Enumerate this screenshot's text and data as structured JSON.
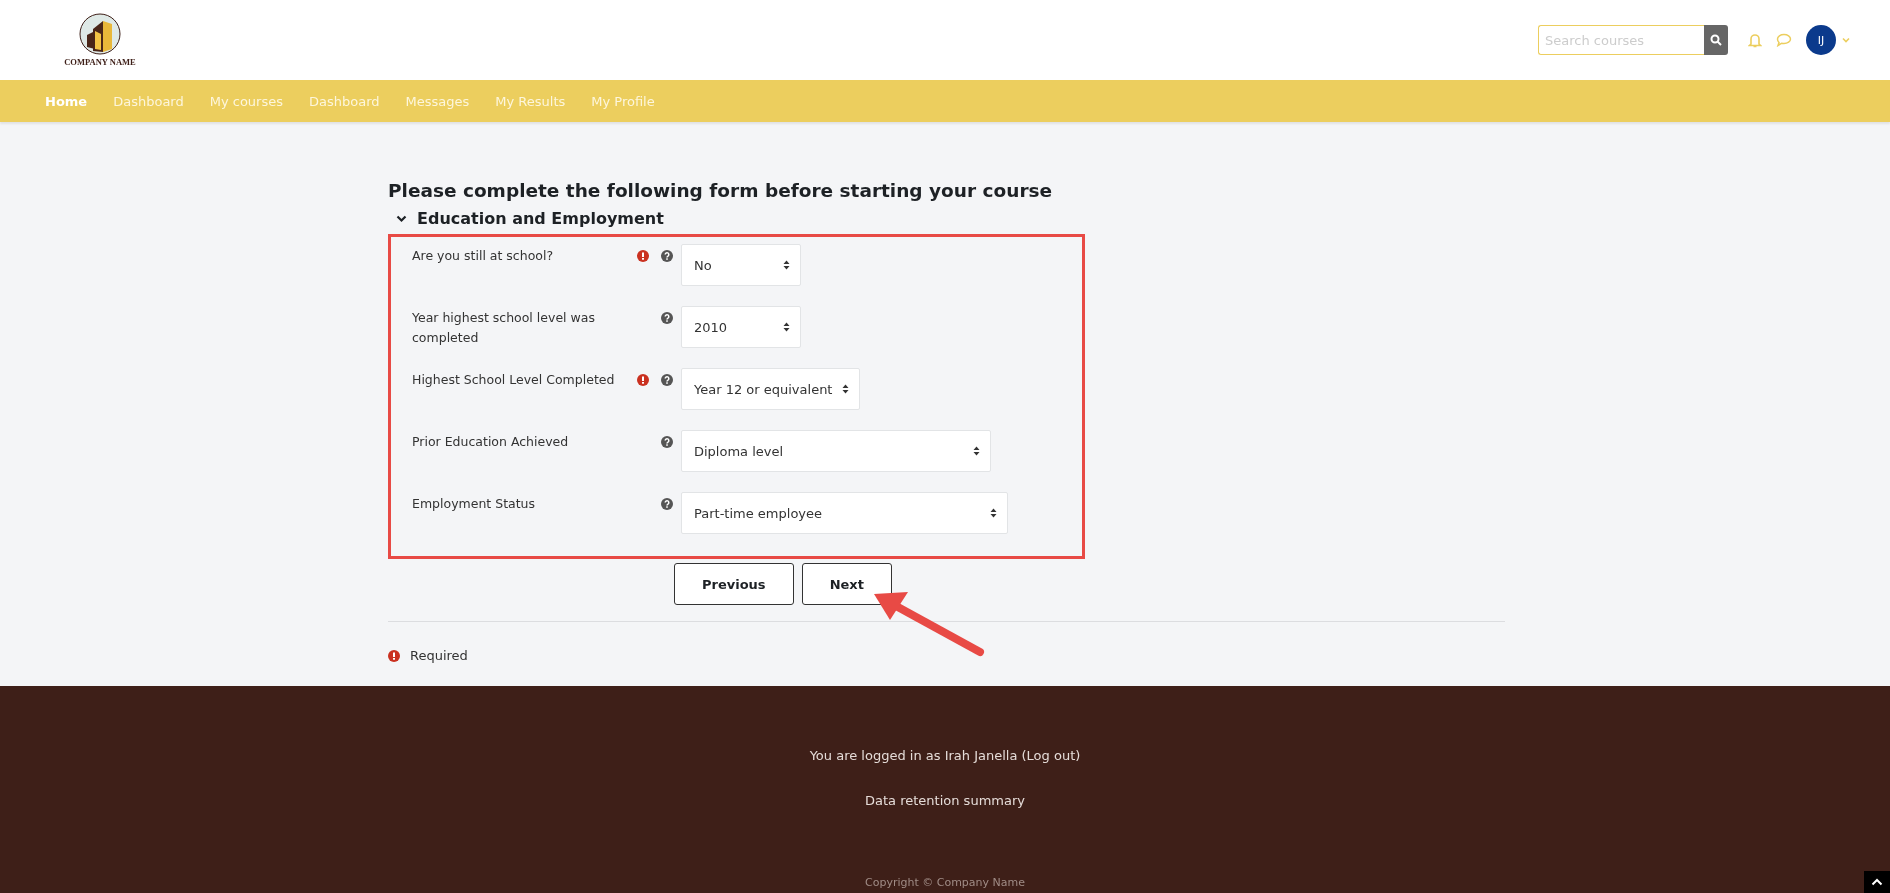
{
  "header": {
    "logo_text": "COMPANY NAME",
    "search": {
      "placeholder": "Search courses"
    },
    "avatar_initials": "IJ"
  },
  "nav": [
    {
      "label": "Home",
      "selected": true
    },
    {
      "label": "Dashboard",
      "selected": false
    },
    {
      "label": "My courses",
      "selected": false
    },
    {
      "label": "Dashboard",
      "selected": false
    },
    {
      "label": "Messages",
      "selected": false
    },
    {
      "label": "My Results",
      "selected": false
    },
    {
      "label": "My Profile",
      "selected": false
    }
  ],
  "page_title": "Please complete the following form before starting your course",
  "section": {
    "title": "Education and Employment",
    "expanded": true
  },
  "fields": [
    {
      "label": "Are you still at school?",
      "required": true,
      "value": "No"
    },
    {
      "label": "Year highest school level was completed",
      "required": false,
      "value": "2010"
    },
    {
      "label": "Highest School Level Completed",
      "required": true,
      "value": "Year 12 or equivalent"
    },
    {
      "label": "Prior Education Achieved",
      "required": false,
      "value": "Diploma level"
    },
    {
      "label": "Employment Status",
      "required": false,
      "value": "Part-time employee"
    }
  ],
  "buttons": [
    "Previous",
    "Next"
  ],
  "required_note": "Required",
  "footer": {
    "logged_in": "You are logged in as Irah Janella (Log out)",
    "data_retention": "Data retention summary",
    "copyright": "Copyright © Company Name"
  }
}
